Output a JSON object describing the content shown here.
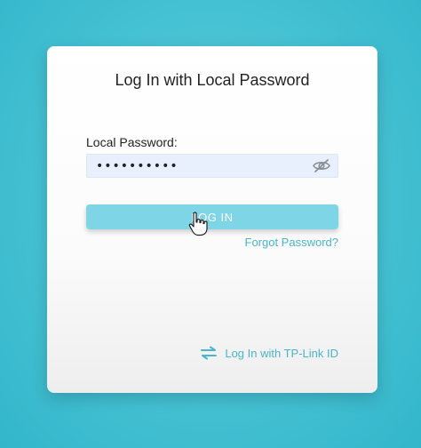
{
  "login_card": {
    "title": "Log In with Local Password",
    "password_label": "Local Password:",
    "password_value": "••••••••••",
    "eye_icon": "eye-slash-icon",
    "login_button_label": "LOG IN",
    "forgot_password_link": "Forgot Password?",
    "tplink_icon": "swap-arrows-icon",
    "tplink_login_link": "Log In with TP-Link ID"
  },
  "colors": {
    "accent": "#4ab4cc",
    "button_bg": "#7dd5e6",
    "input_bg": "#e8f0fd",
    "page_bg": "#49c4d5"
  }
}
